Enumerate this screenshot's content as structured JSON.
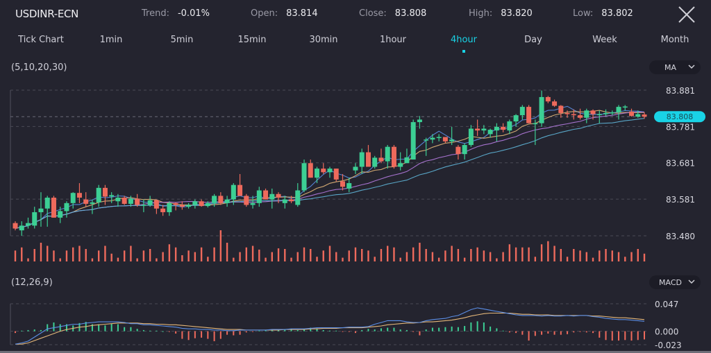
{
  "header": {
    "symbol": "USDINR-ECN",
    "trend_label": "Trend:",
    "trend_value": "-0.01%",
    "open_label": "Open:",
    "open_value": "83.814",
    "close_label": "Close:",
    "close_value": "83.808",
    "high_label": "High:",
    "high_value": "83.820",
    "low_label": "Low:",
    "low_value": "83.802",
    "close_icon": "close-x-icon"
  },
  "tabs": [
    {
      "label": "Tick Chart",
      "active": false
    },
    {
      "label": "1min",
      "active": false
    },
    {
      "label": "5min",
      "active": false
    },
    {
      "label": "15min",
      "active": false
    },
    {
      "label": "30min",
      "active": false
    },
    {
      "label": "1hour",
      "active": false
    },
    {
      "label": "4hour",
      "active": true
    },
    {
      "label": "Day",
      "active": false
    },
    {
      "label": "Week",
      "active": false
    },
    {
      "label": "Month",
      "active": false
    }
  ],
  "main_indicator": {
    "params": "(5,10,20,30)",
    "selector": "MA"
  },
  "sub_indicator": {
    "params": "(12,26,9)",
    "selector": "MACD"
  },
  "colors": {
    "up": "#3ccf94",
    "down": "#ee6a5c",
    "accent": "#19d3e6",
    "ma5": "#5b8ee6",
    "ma10": "#e6b87a",
    "ma20": "#b57be0",
    "ma30": "#5fb5d8",
    "dif": "#5b8ee6",
    "dea": "#e6b87a"
  },
  "chart_data": [
    {
      "type": "candlestick",
      "title": "USDINR-ECN 4hour",
      "ylim": [
        83.48,
        83.881
      ],
      "y_ticks": [
        "83.881",
        "83.781",
        "83.681",
        "83.581",
        "83.480"
      ],
      "y_tick_values": [
        83.881,
        83.781,
        83.681,
        83.581,
        83.48
      ],
      "current_price": "83.808",
      "current_price_value": 83.808,
      "grid": true,
      "ma_periods": [
        5,
        10,
        20,
        30
      ],
      "ohlc": [
        [
          83.515,
          83.52,
          83.495,
          83.5
        ],
        [
          83.495,
          83.52,
          83.48,
          83.508
        ],
        [
          83.508,
          83.53,
          83.5,
          83.515
        ],
        [
          83.508,
          83.56,
          83.5,
          83.545
        ],
        [
          83.545,
          83.6,
          83.505,
          83.555
        ],
        [
          83.555,
          83.59,
          83.505,
          83.585
        ],
        [
          83.585,
          83.59,
          83.53,
          83.53
        ],
        [
          83.53,
          83.56,
          83.515,
          83.548
        ],
        [
          83.548,
          83.575,
          83.53,
          83.57
        ],
        [
          83.57,
          83.6,
          83.555,
          83.598
        ],
        [
          83.598,
          83.625,
          83.57,
          83.585
        ],
        [
          83.58,
          83.6,
          83.56,
          83.568
        ],
        [
          83.568,
          83.58,
          83.54,
          83.572
        ],
        [
          83.572,
          83.62,
          83.56,
          83.612
        ],
        [
          83.612,
          83.62,
          83.565,
          83.588
        ],
        [
          83.588,
          83.6,
          83.57,
          83.592
        ],
        [
          83.575,
          83.595,
          83.56,
          83.585
        ],
        [
          83.585,
          83.59,
          83.565,
          83.568
        ],
        [
          83.568,
          83.59,
          83.56,
          83.582
        ],
        [
          83.582,
          83.595,
          83.56,
          83.565
        ],
        [
          83.565,
          83.58,
          83.545,
          83.565
        ],
        [
          83.565,
          83.59,
          83.56,
          83.578
        ],
        [
          83.578,
          83.58,
          83.54,
          83.555
        ],
        [
          83.555,
          83.565,
          83.535,
          83.545
        ],
        [
          83.545,
          83.575,
          83.535,
          83.57
        ],
        [
          83.57,
          83.572,
          83.55,
          83.565
        ],
        [
          83.565,
          83.575,
          83.552,
          83.56
        ],
        [
          83.56,
          83.57,
          83.555,
          83.565
        ],
        [
          83.565,
          83.58,
          83.555,
          83.575
        ],
        [
          83.575,
          83.58,
          83.56,
          83.562
        ],
        [
          83.562,
          83.575,
          83.558,
          83.57
        ],
        [
          83.57,
          83.595,
          83.56,
          83.59
        ],
        [
          83.59,
          83.6,
          83.565,
          83.57
        ],
        [
          83.57,
          83.59,
          83.56,
          83.58
        ],
        [
          83.58,
          83.625,
          83.565,
          83.62
        ],
        [
          83.62,
          83.65,
          83.59,
          83.59
        ],
        [
          83.59,
          83.595,
          83.56,
          83.565
        ],
        [
          83.565,
          83.59,
          83.555,
          83.57
        ],
        [
          83.57,
          83.615,
          83.56,
          83.605
        ],
        [
          83.605,
          83.61,
          83.58,
          83.58
        ],
        [
          83.58,
          83.61,
          83.555,
          83.595
        ],
        [
          83.595,
          83.6,
          83.57,
          83.585
        ],
        [
          83.57,
          83.59,
          83.555,
          83.58
        ],
        [
          83.58,
          83.59,
          83.57,
          83.575
        ],
        [
          83.565,
          83.625,
          83.56,
          83.605
        ],
        [
          83.605,
          83.69,
          83.6,
          83.68
        ],
        [
          83.68,
          83.69,
          83.64,
          83.64
        ],
        [
          83.64,
          83.67,
          83.625,
          83.665
        ],
        [
          83.665,
          83.68,
          83.65,
          83.655
        ],
        [
          83.655,
          83.67,
          83.64,
          83.665
        ],
        [
          83.665,
          83.665,
          83.63,
          83.635
        ],
        [
          83.63,
          83.65,
          83.605,
          83.615
        ],
        [
          83.61,
          83.64,
          83.6,
          83.625
        ],
        [
          83.66,
          83.68,
          83.65,
          83.67
        ],
        [
          83.67,
          83.72,
          83.65,
          83.71
        ],
        [
          83.71,
          83.73,
          83.67,
          83.67
        ],
        [
          83.67,
          83.7,
          83.665,
          83.695
        ],
        [
          83.695,
          83.72,
          83.68,
          83.685
        ],
        [
          83.685,
          83.73,
          83.665,
          83.725
        ],
        [
          83.725,
          83.73,
          83.665,
          83.67
        ],
        [
          83.67,
          83.71,
          83.66,
          83.68
        ],
        [
          83.68,
          83.72,
          83.69,
          83.696
        ],
        [
          83.69,
          83.8,
          83.78,
          83.793
        ],
        [
          83.793,
          83.81,
          83.775,
          83.8
        ],
        [
          83.745,
          83.75,
          83.7,
          83.745
        ],
        [
          83.745,
          83.76,
          83.735,
          83.75
        ],
        [
          83.75,
          83.76,
          83.74,
          83.752
        ],
        [
          83.752,
          83.75,
          83.735,
          83.74
        ],
        [
          83.74,
          83.78,
          83.73,
          83.745
        ],
        [
          83.725,
          83.73,
          83.69,
          83.705
        ],
        [
          83.705,
          83.735,
          83.69,
          83.73
        ],
        [
          83.73,
          83.785,
          83.725,
          83.775
        ],
        [
          83.775,
          83.8,
          83.755,
          83.77
        ],
        [
          83.77,
          83.785,
          83.76,
          83.775
        ],
        [
          83.76,
          83.775,
          83.75,
          83.772
        ],
        [
          83.77,
          83.79,
          83.74,
          83.78
        ],
        [
          83.78,
          83.79,
          83.765,
          83.772
        ],
        [
          83.77,
          83.8,
          83.76,
          83.795
        ],
        [
          83.795,
          83.815,
          83.78,
          83.812
        ],
        [
          83.812,
          83.84,
          83.8,
          83.835
        ],
        [
          83.835,
          83.84,
          83.79,
          83.79
        ],
        [
          83.79,
          83.8,
          83.73,
          83.79
        ],
        [
          83.79,
          83.88,
          83.78,
          83.862
        ],
        [
          83.862,
          83.865,
          83.845,
          83.85
        ],
        [
          83.85,
          83.855,
          83.835,
          83.838
        ],
        [
          83.838,
          83.84,
          83.805,
          83.818
        ],
        [
          83.818,
          83.825,
          83.805,
          83.815
        ],
        [
          83.815,
          83.828,
          83.8,
          83.812
        ],
        [
          83.812,
          83.83,
          83.8,
          83.805
        ],
        [
          83.805,
          83.83,
          83.79,
          83.825
        ],
        [
          83.825,
          83.828,
          83.8,
          83.815
        ],
        [
          83.815,
          83.825,
          83.79,
          83.815
        ],
        [
          83.815,
          83.828,
          83.81,
          83.818
        ],
        [
          83.818,
          83.825,
          83.812,
          83.82
        ],
        [
          83.82,
          83.84,
          83.8,
          83.835
        ],
        [
          83.835,
          83.84,
          83.825,
          83.836
        ],
        [
          83.822,
          83.83,
          83.808,
          83.81
        ],
        [
          83.808,
          83.825,
          83.805,
          83.815
        ],
        [
          83.814,
          83.82,
          83.802,
          83.808
        ]
      ]
    },
    {
      "type": "bar",
      "title": "Volume",
      "series_note": "relative volume per candle (0-1)",
      "values": [
        0.35,
        0.45,
        0.1,
        0.4,
        0.6,
        0.5,
        0.35,
        0.1,
        0.35,
        0.45,
        0.5,
        0.4,
        0.1,
        0.35,
        0.5,
        0.25,
        0.12,
        0.35,
        0.5,
        0.1,
        0.35,
        0.4,
        0.1,
        0.3,
        0.55,
        0.45,
        0.2,
        0.35,
        0.3,
        0.45,
        0.15,
        0.45,
        1.0,
        0.6,
        0.12,
        0.3,
        0.45,
        0.5,
        0.38,
        0.12,
        0.3,
        0.42,
        0.4,
        0.12,
        0.3,
        0.45,
        0.4,
        0.15,
        0.35,
        0.5,
        0.3,
        0.12,
        0.35,
        0.45,
        0.4,
        0.35,
        0.15,
        0.4,
        0.5,
        0.45,
        0.12,
        0.3,
        0.45,
        0.6,
        0.4,
        0.3,
        0.12,
        0.35,
        0.5,
        0.4,
        0.12,
        0.4,
        0.45,
        0.35,
        0.3,
        0.1,
        0.3,
        0.55,
        0.45,
        0.45,
        0.45,
        0.15,
        0.55,
        0.65,
        0.5,
        0.4,
        0.15,
        0.4,
        0.35,
        0.3,
        0.12,
        0.35,
        0.4,
        0.35,
        0.3,
        0.15,
        0.3,
        0.4,
        0.25
      ]
    },
    {
      "type": "macd",
      "params": [
        12,
        26,
        9
      ],
      "ylim": [
        -0.023,
        0.047
      ],
      "y_ticks": [
        "0.047",
        "0.000",
        "-0.023"
      ],
      "y_tick_values": [
        0.047,
        0.0,
        -0.023
      ],
      "histogram": [
        -0.003,
        0.001,
        0.002,
        0.003,
        0.002,
        0.012,
        0.015,
        0.012,
        0.012,
        0.01,
        0.014,
        0.016,
        0.012,
        0.012,
        0.01,
        0.013,
        0.012,
        0.007,
        0.007,
        0.004,
        0.002,
        0.001,
        0.001,
        0.0,
        -0.001,
        -0.004,
        -0.013,
        -0.015,
        -0.012,
        -0.011,
        -0.013,
        -0.017,
        -0.013,
        -0.006,
        -0.007,
        -0.006,
        -0.002,
        -0.001,
        0.001,
        0.002,
        0.003,
        0.003,
        0.003,
        0.003,
        0.002,
        0.004,
        0.006,
        0.005,
        0.002,
        0.001,
        0.001,
        -0.001,
        -0.001,
        -0.003,
        0.002,
        0.004,
        0.003,
        0.005,
        0.006,
        0.006,
        0.003,
        0.002,
        -0.001,
        -0.007,
        0.003,
        0.006,
        0.006,
        0.007,
        0.008,
        0.007,
        0.009,
        0.015,
        0.017,
        0.015,
        0.008,
        0.005,
        0.001,
        -0.002,
        -0.003,
        -0.006,
        -0.016,
        -0.008,
        -0.006,
        -0.004,
        -0.006,
        -0.006,
        -0.005,
        -0.002,
        -0.001,
        -0.002,
        -0.003,
        -0.011,
        -0.015,
        -0.016,
        -0.016,
        -0.015,
        -0.016,
        -0.015,
        -0.014
      ],
      "dif": [
        -0.022,
        -0.02,
        -0.017,
        -0.01,
        -0.003,
        0.004,
        0.006,
        0.008,
        0.01,
        0.012,
        0.012,
        0.014,
        0.015,
        0.016,
        0.016,
        0.016,
        0.016,
        0.015,
        0.013,
        0.013,
        0.011,
        0.011,
        0.01,
        0.009,
        0.008,
        0.007,
        0.005,
        0.004,
        0.004,
        0.003,
        0.003,
        0.002,
        0.002,
        0.001,
        0.001,
        0.002,
        0.002,
        0.002,
        0.002,
        0.002,
        0.003,
        0.003,
        0.003,
        0.004,
        0.004,
        0.004,
        0.005,
        0.006,
        0.006,
        0.006,
        0.006,
        0.006,
        0.007,
        0.007,
        0.007,
        0.008,
        0.012,
        0.015,
        0.018,
        0.018,
        0.018,
        0.016,
        0.015,
        0.015,
        0.018,
        0.02,
        0.021,
        0.022,
        0.025,
        0.027,
        0.032,
        0.037,
        0.04,
        0.038,
        0.036,
        0.034,
        0.032,
        0.03,
        0.028,
        0.027,
        0.027,
        0.027,
        0.026,
        0.027,
        0.026,
        0.026,
        0.027,
        0.026,
        0.027,
        0.027,
        0.025,
        0.024,
        0.022,
        0.021,
        0.02,
        0.02,
        0.019,
        0.018,
        0.017
      ],
      "dea": [
        -0.022,
        -0.022,
        -0.02,
        -0.016,
        -0.012,
        -0.008,
        -0.004,
        0.0,
        0.003,
        0.005,
        0.007,
        0.008,
        0.01,
        0.011,
        0.012,
        0.013,
        0.014,
        0.014,
        0.014,
        0.014,
        0.013,
        0.013,
        0.012,
        0.012,
        0.011,
        0.011,
        0.01,
        0.009,
        0.008,
        0.007,
        0.006,
        0.005,
        0.004,
        0.003,
        0.003,
        0.003,
        0.002,
        0.002,
        0.002,
        0.002,
        0.002,
        0.002,
        0.003,
        0.003,
        0.003,
        0.003,
        0.004,
        0.004,
        0.005,
        0.005,
        0.005,
        0.006,
        0.006,
        0.006,
        0.006,
        0.007,
        0.008,
        0.009,
        0.011,
        0.012,
        0.013,
        0.014,
        0.014,
        0.015,
        0.016,
        0.016,
        0.017,
        0.018,
        0.019,
        0.021,
        0.023,
        0.026,
        0.028,
        0.03,
        0.031,
        0.031,
        0.031,
        0.031,
        0.03,
        0.029,
        0.029,
        0.028,
        0.028,
        0.028,
        0.027,
        0.027,
        0.027,
        0.027,
        0.027,
        0.027,
        0.026,
        0.026,
        0.025,
        0.024,
        0.023,
        0.023,
        0.022,
        0.021,
        0.02
      ]
    }
  ]
}
